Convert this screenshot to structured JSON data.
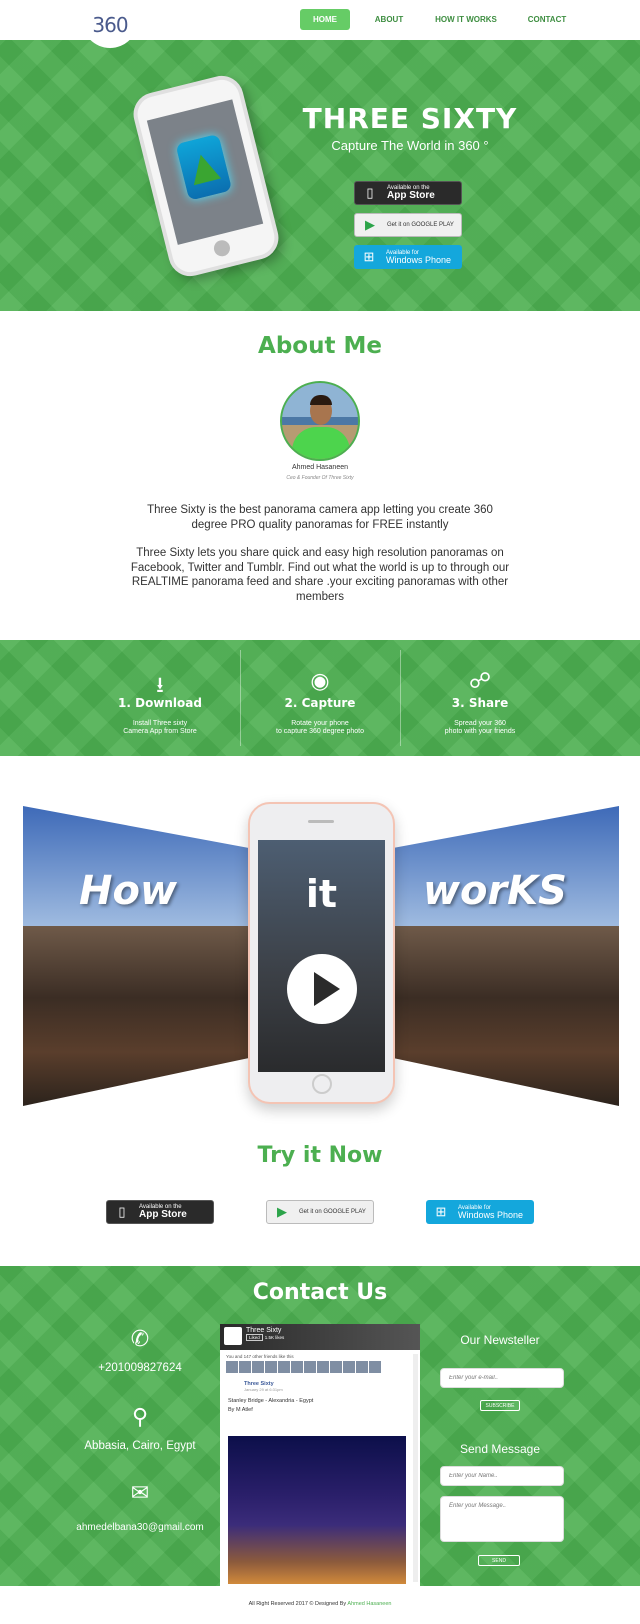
{
  "nav": {
    "logo": "360",
    "items": [
      {
        "label": "HOME",
        "active": true
      },
      {
        "label": "ABOUT",
        "active": false
      },
      {
        "label": "HOW IT WORKS",
        "active": false
      },
      {
        "label": "CONTACT",
        "active": false
      }
    ]
  },
  "hero": {
    "title": "THREE  SIXTY",
    "subtitle": "Capture The World in 360 °",
    "stores": {
      "apple_small": "Available on the",
      "apple_big": "App Store",
      "google_small": "",
      "google_big": "Get it on GOOGLE PLAY",
      "windows_small": "Available for",
      "windows_big": "Windows Phone"
    }
  },
  "about": {
    "title": "About Me",
    "name": "Ahmed Hasaneen",
    "role": "Ceo & Founder Of Three Sixty",
    "paragraph1": "Three Sixty is the best panorama camera app letting you create 360 degree PRO quality panoramas for FREE instantly",
    "paragraph2": "Three Sixty lets you share quick and easy high resolution panoramas on Facebook, Twitter and Tumblr. Find out what the world is up to through our REALTIME panorama feed and share .your exciting panoramas with other members"
  },
  "steps": [
    {
      "icon": "download-icon",
      "glyph": "⭳",
      "title": "1. Download",
      "desc1": "Install Three sixty",
      "desc2": "Camera App from Store"
    },
    {
      "icon": "camera-icon",
      "glyph": "◉",
      "title": "2.  Capture",
      "desc1": "Rotate your phone",
      "desc2": "to capture 360 degree photo"
    },
    {
      "icon": "share-icon",
      "glyph": "☍",
      "title": "3.  Share",
      "desc1": "Spread your 360",
      "desc2": "photo with your friends"
    }
  ],
  "how": {
    "word1": "How",
    "word2": "it",
    "word3": "worKS"
  },
  "try": {
    "title": "Try it Now"
  },
  "contact": {
    "title": "Contact Us",
    "phone": "+201009827624",
    "address": "Abbasia, Cairo, Egypt",
    "email": "ahmedelbana30@gmail.com",
    "fb": {
      "page_name": "Three Sixty",
      "liked": "Liked",
      "likes": "1.5K likes",
      "friends": "You and 147 other friends like this",
      "post_name": "Three Sixty",
      "post_date": "January 29 at 6:31pm",
      "post_text": "Stanley Bridge - Alexandria - Egypt",
      "post_by": "By   M Atlef"
    },
    "newsletter_title": "Our Newsteller",
    "email_placeholder": "Enter your e-mail..",
    "subscribe": "SUBSCRIBE",
    "message_title": "Send Message",
    "name_placeholder": "Enter your Name..",
    "message_placeholder": "Enter your Message..",
    "send": "SEND"
  },
  "footer": {
    "text": "All Right Reserved 2017 © Designed By",
    "author": "Ahmed Hasaneen"
  },
  "colors": {
    "brand_green": "#4caf50",
    "nav_active": "#66cc66",
    "windows_blue": "#14a7dc"
  }
}
